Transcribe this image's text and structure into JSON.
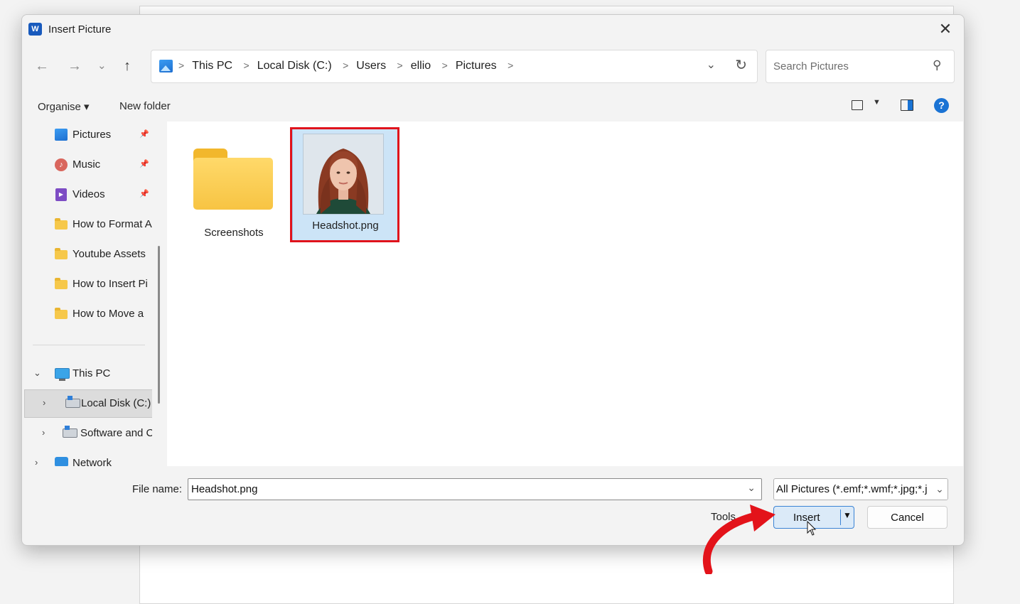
{
  "dialog": {
    "title": "Insert Picture",
    "app_icon_letter": "W"
  },
  "address_bar": {
    "crumbs": [
      "This PC",
      "Local Disk (C:)",
      "Users",
      "ellio",
      "Pictures"
    ]
  },
  "search": {
    "placeholder": "Search Pictures"
  },
  "toolbar": {
    "organise_label": "Organise ▾",
    "new_folder_label": "New folder",
    "help_label": "?"
  },
  "sidebar": {
    "quick_access": [
      {
        "label": "Pictures",
        "icon": "pictures-icon",
        "pinned": true
      },
      {
        "label": "Music",
        "icon": "music-icon",
        "pinned": true
      },
      {
        "label": "Videos",
        "icon": "videos-icon",
        "pinned": true
      },
      {
        "label": "How to Format A",
        "icon": "folder-icon",
        "pinned": false
      },
      {
        "label": "Youtube Assets",
        "icon": "folder-icon",
        "pinned": false
      },
      {
        "label": "How to Insert Pi",
        "icon": "folder-icon",
        "pinned": false
      },
      {
        "label": "How to Move a",
        "icon": "folder-icon",
        "pinned": false
      }
    ],
    "tree": [
      {
        "label": "This PC",
        "icon": "computer-icon",
        "expanded": true
      },
      {
        "label": "Local Disk (C:)",
        "icon": "disk-icon",
        "selected": true
      },
      {
        "label": "Software and C",
        "icon": "disk-icon",
        "selected": false
      },
      {
        "label": "Network",
        "icon": "network-icon",
        "selected": false
      }
    ]
  },
  "files": [
    {
      "name": "Screenshots",
      "type": "folder",
      "selected": false
    },
    {
      "name": "Headshot.png",
      "type": "image",
      "selected": true
    }
  ],
  "footer": {
    "file_name_label": "File name:",
    "file_name_value": "Headshot.png",
    "file_type_value": "All Pictures (*.emf;*.wmf;*.jpg;*.j",
    "tools_label": "Tools",
    "insert_label": "Insert",
    "cancel_label": "Cancel"
  },
  "colors": {
    "accent": "#1a73d4",
    "highlight_box": "#e0131c",
    "selection_fill": "#cce4f7",
    "arrow_overlay": "#e3131a"
  }
}
